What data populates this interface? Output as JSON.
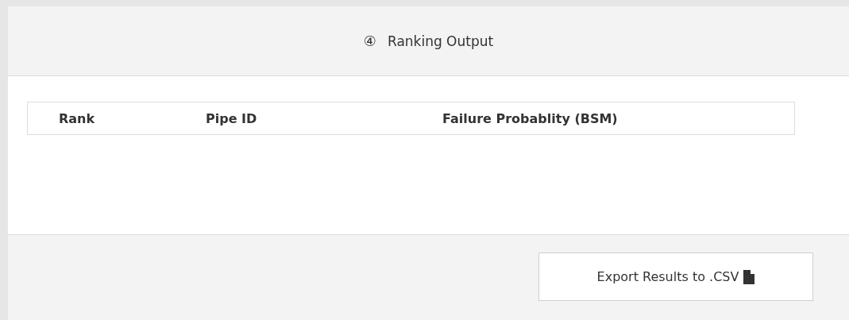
{
  "panel": {
    "step": "④",
    "title": "Ranking Output"
  },
  "table": {
    "columns": [
      "Rank",
      "Pipe ID",
      "Failure Probablity (BSM)"
    ]
  },
  "footer": {
    "export_button": "Export Results to .CSV"
  }
}
